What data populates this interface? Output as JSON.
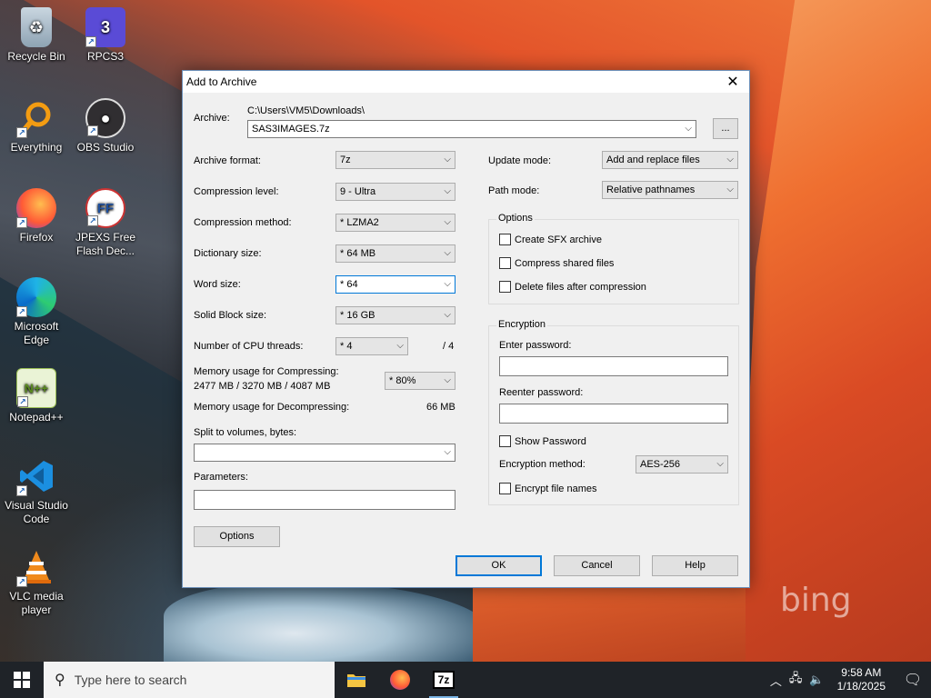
{
  "desktop": {
    "icons": [
      {
        "label": "Recycle Bin",
        "icon": "recycle-bin-icon"
      },
      {
        "label": "RPCS3",
        "icon": "rpcs3-icon"
      },
      {
        "label": "Everything",
        "icon": "everything-icon"
      },
      {
        "label": "OBS Studio",
        "icon": "obs-studio-icon"
      },
      {
        "label": "Firefox",
        "icon": "firefox-icon"
      },
      {
        "label": "JPEXS Free Flash Dec...",
        "icon": "jpexs-icon"
      },
      {
        "label": "Microsoft Edge",
        "icon": "edge-icon"
      },
      {
        "label": "Notepad++",
        "icon": "notepadpp-icon"
      },
      {
        "label": "Visual Studio Code",
        "icon": "vscode-icon"
      },
      {
        "label": "VLC media player",
        "icon": "vlc-icon"
      }
    ],
    "wallpaper_brand": "bing"
  },
  "dialog": {
    "title": "Add to Archive",
    "archive": {
      "label": "Archive:",
      "path": "C:\\Users\\VM5\\Downloads\\",
      "filename": "SAS3IMAGES.7z",
      "browse_label": "..."
    },
    "left": {
      "archive_format": {
        "label": "Archive format:",
        "value": "7z"
      },
      "compression_level": {
        "label": "Compression level:",
        "value": "9 - Ultra"
      },
      "compression_method": {
        "label": "Compression method:",
        "value": "* LZMA2"
      },
      "dictionary_size": {
        "label": "Dictionary size:",
        "value": "* 64 MB"
      },
      "word_size": {
        "label": "Word size:",
        "value": "* 64"
      },
      "solid_block_size": {
        "label": "Solid Block size:",
        "value": "* 16 GB"
      },
      "cpu_threads": {
        "label": "Number of CPU threads:",
        "value": "* 4",
        "max": "/ 4"
      },
      "mem_compress": {
        "label": "Memory usage for Compressing:",
        "detail": "2477 MB / 3270 MB / 4087 MB",
        "value": "* 80%"
      },
      "mem_decompress": {
        "label": "Memory usage for Decompressing:",
        "value": "66 MB"
      },
      "split": {
        "label": "Split to volumes, bytes:",
        "value": ""
      },
      "parameters": {
        "label": "Parameters:",
        "value": ""
      },
      "options_button": "Options"
    },
    "right": {
      "update_mode": {
        "label": "Update mode:",
        "value": "Add and replace files"
      },
      "path_mode": {
        "label": "Path mode:",
        "value": "Relative pathnames"
      },
      "options_group": {
        "title": "Options",
        "create_sfx": "Create SFX archive",
        "compress_shared": "Compress shared files",
        "delete_after": "Delete files after compression"
      },
      "encryption_group": {
        "title": "Encryption",
        "enter_password": "Enter password:",
        "reenter_password": "Reenter password:",
        "show_password": "Show Password",
        "method_label": "Encryption method:",
        "method_value": "AES-256",
        "encrypt_names": "Encrypt file names"
      }
    },
    "buttons": {
      "ok": "OK",
      "cancel": "Cancel",
      "help": "Help"
    }
  },
  "taskbar": {
    "search_placeholder": "Type here to search",
    "time": "9:58 AM",
    "date": "1/18/2025"
  }
}
